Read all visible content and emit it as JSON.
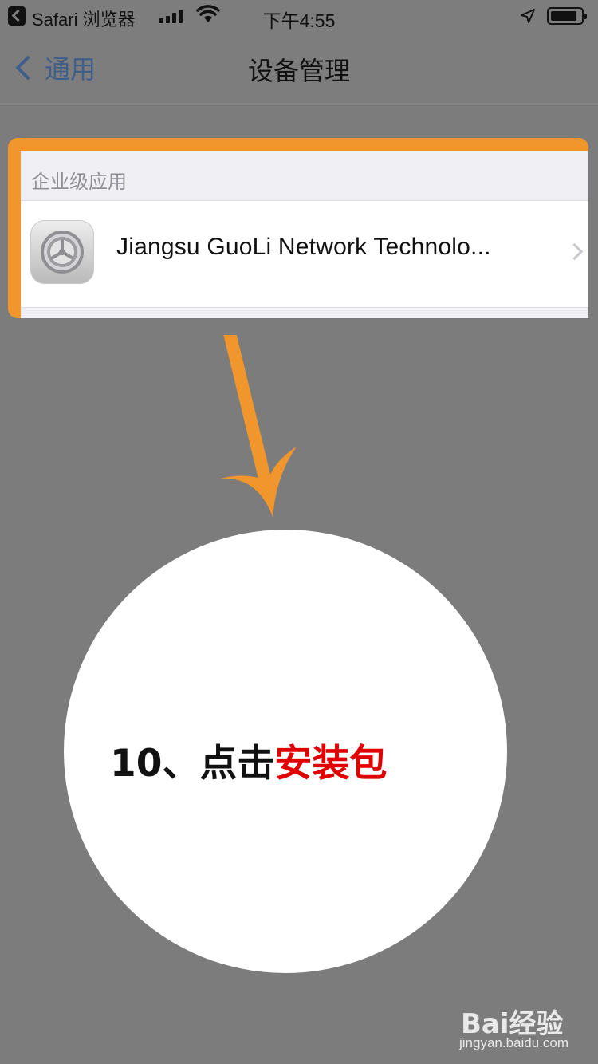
{
  "status_bar": {
    "app_name": "Safari 浏览器",
    "time": "下午4:55"
  },
  "nav": {
    "back_label": "通用",
    "title": "设备管理"
  },
  "section": {
    "header": "企业级应用",
    "items": [
      {
        "label": "Jiangsu GuoLi Network Technolo...",
        "icon": "settings-gear-icon"
      }
    ]
  },
  "annotation": {
    "step_prefix": "10、点击",
    "step_highlight": "安装包",
    "frame_color": "#f0962d",
    "highlight_color": "#e00000"
  },
  "watermark": {
    "logo_text": "Bai经验",
    "url": "jingyan.baidu.com"
  }
}
